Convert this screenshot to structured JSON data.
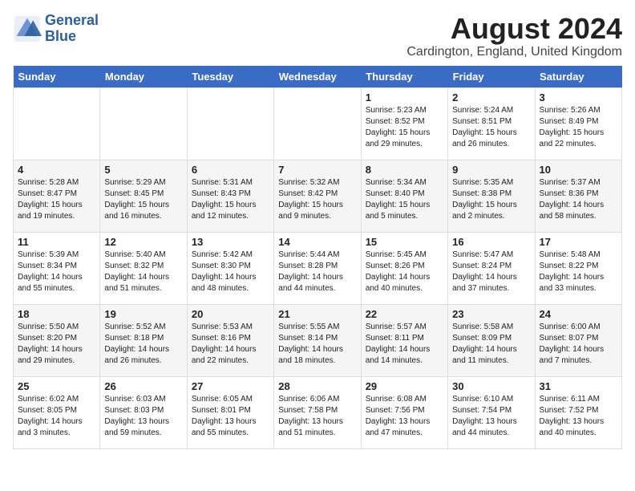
{
  "logo": {
    "line1": "General",
    "line2": "Blue"
  },
  "title": "August 2024",
  "subtitle": "Cardington, England, United Kingdom",
  "days_of_week": [
    "Sunday",
    "Monday",
    "Tuesday",
    "Wednesday",
    "Thursday",
    "Friday",
    "Saturday"
  ],
  "weeks": [
    [
      {
        "day": "",
        "info": ""
      },
      {
        "day": "",
        "info": ""
      },
      {
        "day": "",
        "info": ""
      },
      {
        "day": "",
        "info": ""
      },
      {
        "day": "1",
        "info": "Sunrise: 5:23 AM\nSunset: 8:52 PM\nDaylight: 15 hours\nand 29 minutes."
      },
      {
        "day": "2",
        "info": "Sunrise: 5:24 AM\nSunset: 8:51 PM\nDaylight: 15 hours\nand 26 minutes."
      },
      {
        "day": "3",
        "info": "Sunrise: 5:26 AM\nSunset: 8:49 PM\nDaylight: 15 hours\nand 22 minutes."
      }
    ],
    [
      {
        "day": "4",
        "info": "Sunrise: 5:28 AM\nSunset: 8:47 PM\nDaylight: 15 hours\nand 19 minutes."
      },
      {
        "day": "5",
        "info": "Sunrise: 5:29 AM\nSunset: 8:45 PM\nDaylight: 15 hours\nand 16 minutes."
      },
      {
        "day": "6",
        "info": "Sunrise: 5:31 AM\nSunset: 8:43 PM\nDaylight: 15 hours\nand 12 minutes."
      },
      {
        "day": "7",
        "info": "Sunrise: 5:32 AM\nSunset: 8:42 PM\nDaylight: 15 hours\nand 9 minutes."
      },
      {
        "day": "8",
        "info": "Sunrise: 5:34 AM\nSunset: 8:40 PM\nDaylight: 15 hours\nand 5 minutes."
      },
      {
        "day": "9",
        "info": "Sunrise: 5:35 AM\nSunset: 8:38 PM\nDaylight: 15 hours\nand 2 minutes."
      },
      {
        "day": "10",
        "info": "Sunrise: 5:37 AM\nSunset: 8:36 PM\nDaylight: 14 hours\nand 58 minutes."
      }
    ],
    [
      {
        "day": "11",
        "info": "Sunrise: 5:39 AM\nSunset: 8:34 PM\nDaylight: 14 hours\nand 55 minutes."
      },
      {
        "day": "12",
        "info": "Sunrise: 5:40 AM\nSunset: 8:32 PM\nDaylight: 14 hours\nand 51 minutes."
      },
      {
        "day": "13",
        "info": "Sunrise: 5:42 AM\nSunset: 8:30 PM\nDaylight: 14 hours\nand 48 minutes."
      },
      {
        "day": "14",
        "info": "Sunrise: 5:44 AM\nSunset: 8:28 PM\nDaylight: 14 hours\nand 44 minutes."
      },
      {
        "day": "15",
        "info": "Sunrise: 5:45 AM\nSunset: 8:26 PM\nDaylight: 14 hours\nand 40 minutes."
      },
      {
        "day": "16",
        "info": "Sunrise: 5:47 AM\nSunset: 8:24 PM\nDaylight: 14 hours\nand 37 minutes."
      },
      {
        "day": "17",
        "info": "Sunrise: 5:48 AM\nSunset: 8:22 PM\nDaylight: 14 hours\nand 33 minutes."
      }
    ],
    [
      {
        "day": "18",
        "info": "Sunrise: 5:50 AM\nSunset: 8:20 PM\nDaylight: 14 hours\nand 29 minutes."
      },
      {
        "day": "19",
        "info": "Sunrise: 5:52 AM\nSunset: 8:18 PM\nDaylight: 14 hours\nand 26 minutes."
      },
      {
        "day": "20",
        "info": "Sunrise: 5:53 AM\nSunset: 8:16 PM\nDaylight: 14 hours\nand 22 minutes."
      },
      {
        "day": "21",
        "info": "Sunrise: 5:55 AM\nSunset: 8:14 PM\nDaylight: 14 hours\nand 18 minutes."
      },
      {
        "day": "22",
        "info": "Sunrise: 5:57 AM\nSunset: 8:11 PM\nDaylight: 14 hours\nand 14 minutes."
      },
      {
        "day": "23",
        "info": "Sunrise: 5:58 AM\nSunset: 8:09 PM\nDaylight: 14 hours\nand 11 minutes."
      },
      {
        "day": "24",
        "info": "Sunrise: 6:00 AM\nSunset: 8:07 PM\nDaylight: 14 hours\nand 7 minutes."
      }
    ],
    [
      {
        "day": "25",
        "info": "Sunrise: 6:02 AM\nSunset: 8:05 PM\nDaylight: 14 hours\nand 3 minutes."
      },
      {
        "day": "26",
        "info": "Sunrise: 6:03 AM\nSunset: 8:03 PM\nDaylight: 13 hours\nand 59 minutes."
      },
      {
        "day": "27",
        "info": "Sunrise: 6:05 AM\nSunset: 8:01 PM\nDaylight: 13 hours\nand 55 minutes."
      },
      {
        "day": "28",
        "info": "Sunrise: 6:06 AM\nSunset: 7:58 PM\nDaylight: 13 hours\nand 51 minutes."
      },
      {
        "day": "29",
        "info": "Sunrise: 6:08 AM\nSunset: 7:56 PM\nDaylight: 13 hours\nand 47 minutes."
      },
      {
        "day": "30",
        "info": "Sunrise: 6:10 AM\nSunset: 7:54 PM\nDaylight: 13 hours\nand 44 minutes."
      },
      {
        "day": "31",
        "info": "Sunrise: 6:11 AM\nSunset: 7:52 PM\nDaylight: 13 hours\nand 40 minutes."
      }
    ]
  ]
}
